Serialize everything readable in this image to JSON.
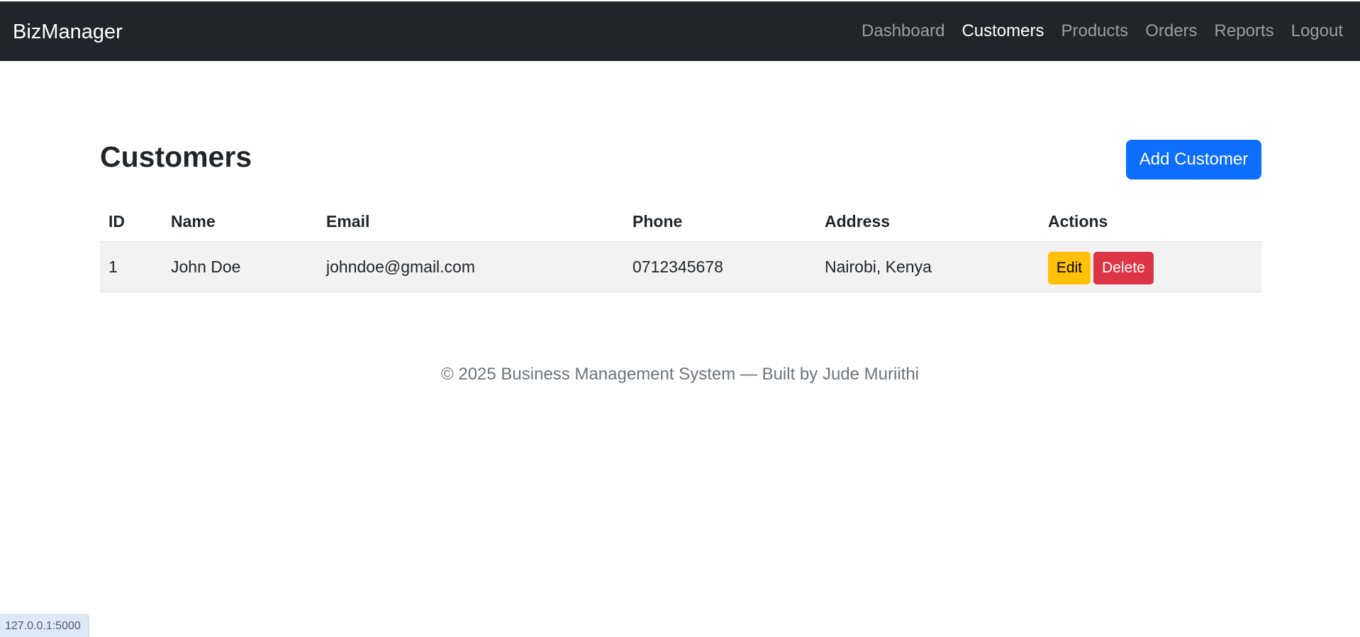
{
  "navbar": {
    "brand": "BizManager",
    "links": [
      {
        "label": "Dashboard",
        "active": false
      },
      {
        "label": "Customers",
        "active": true
      },
      {
        "label": "Products",
        "active": false
      },
      {
        "label": "Orders",
        "active": false
      },
      {
        "label": "Reports",
        "active": false
      },
      {
        "label": "Logout",
        "active": false
      }
    ]
  },
  "main": {
    "title": "Customers",
    "add_button_label": "Add Customer",
    "table": {
      "columns": [
        "ID",
        "Name",
        "Email",
        "Phone",
        "Address",
        "Actions"
      ],
      "rows": [
        {
          "id": "1",
          "name": "John Doe",
          "email": "johndoe@gmail.com",
          "phone": "0712345678",
          "address": "Nairobi, Kenya",
          "edit_label": "Edit",
          "delete_label": "Delete"
        }
      ]
    }
  },
  "footer": {
    "text": "© 2025 Business Management System — Built by Jude Muriithi"
  },
  "status_bar": {
    "url": "127.0.0.1:5000"
  },
  "colors": {
    "navbar_bg": "#212529",
    "primary": "#0d6efd",
    "warning": "#ffc107",
    "danger": "#dc3545",
    "muted": "#6c757d"
  }
}
